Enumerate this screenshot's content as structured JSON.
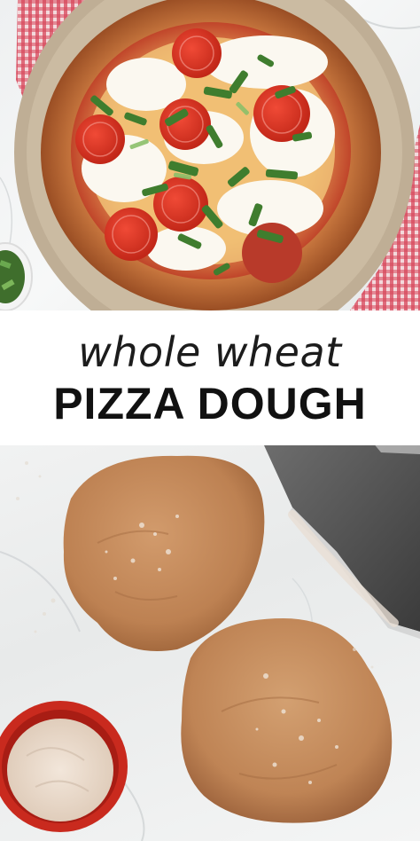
{
  "title": {
    "line1": "whole wheat",
    "line2": "PIZZA DOUGH"
  },
  "images": {
    "top": "pizza-photo",
    "bottom": "dough-photo"
  },
  "colors": {
    "crust": "#b86a3a",
    "sauce": "#c0452a",
    "mozzarella": "#faf6ee",
    "basil": "#3f7d2e",
    "dough": "#c0875a",
    "tablecloth": "#c8344a",
    "marble": "#eef0f1",
    "title_text": "#111111"
  }
}
